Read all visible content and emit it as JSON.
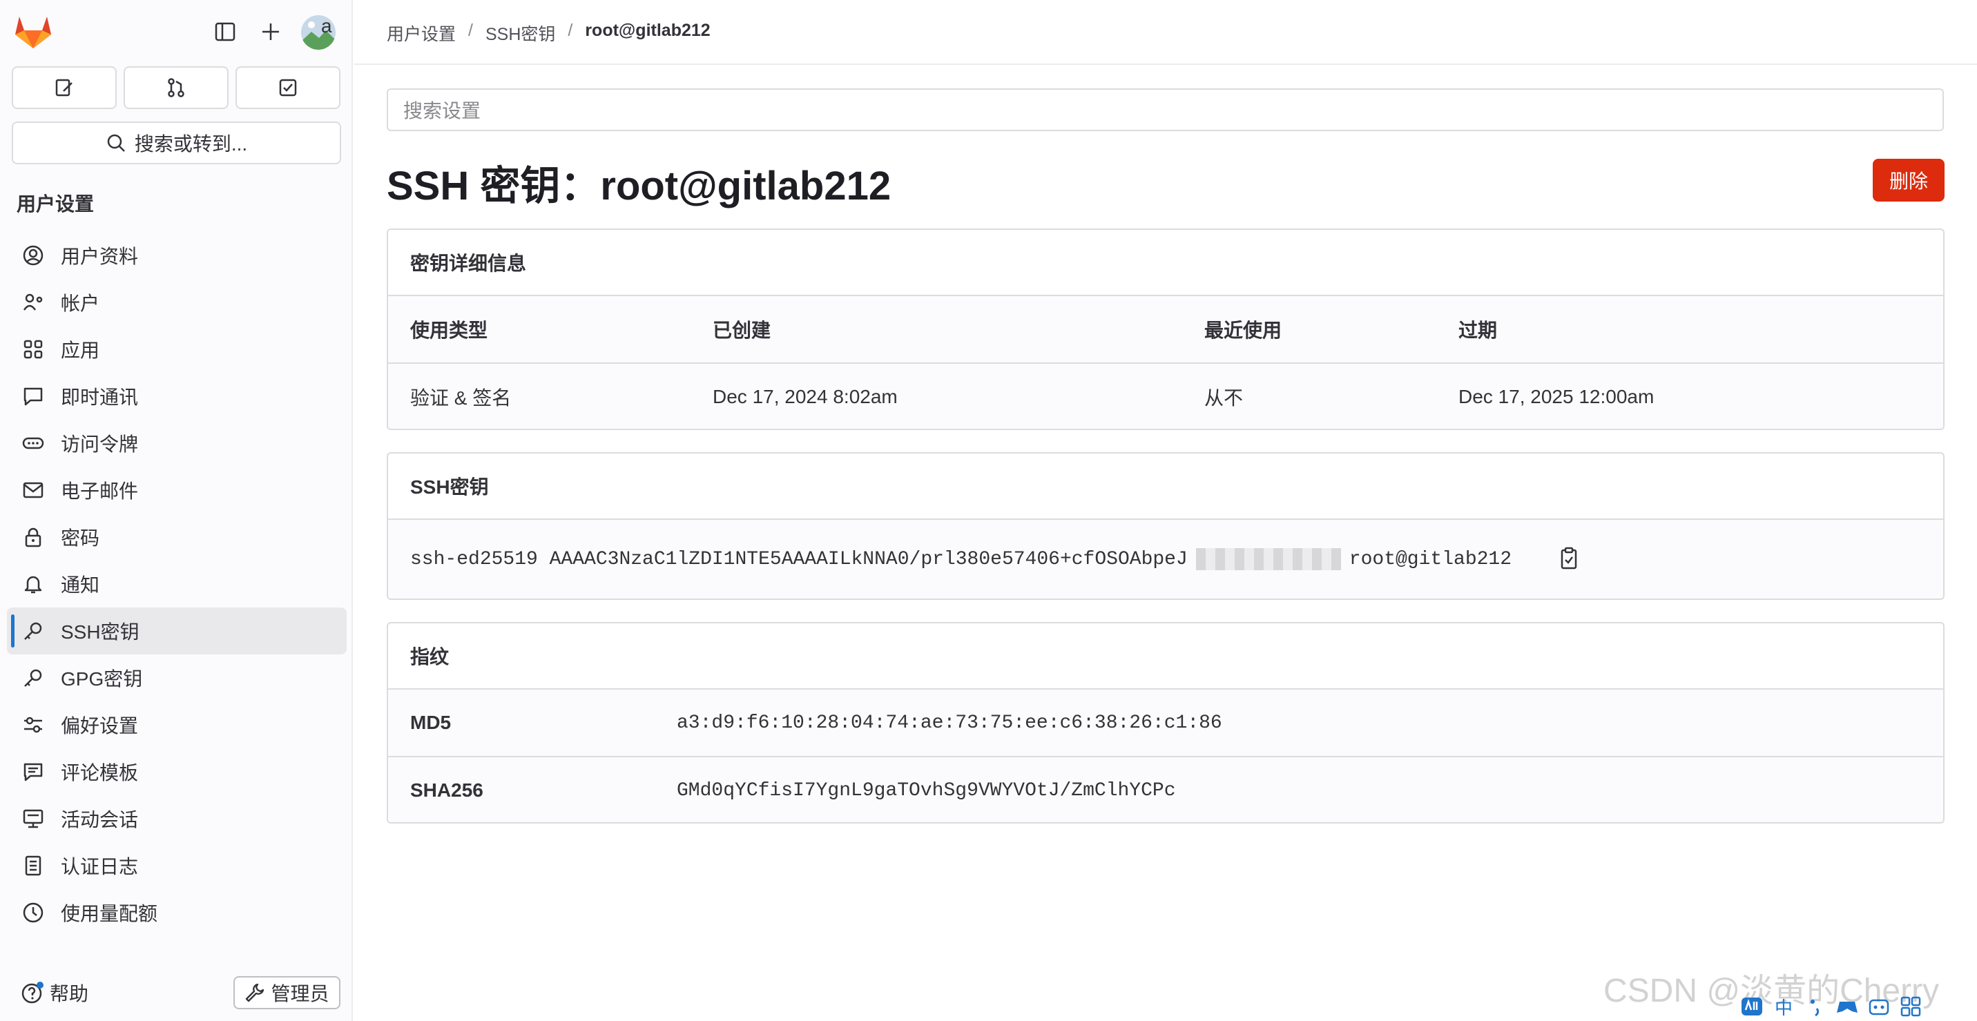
{
  "sidebar": {
    "avatar_text": "a",
    "search_label": "搜索或转到...",
    "section_title": "用户设置",
    "items": [
      {
        "label": "用户资料",
        "icon": "profile-icon"
      },
      {
        "label": "帐户",
        "icon": "account-icon"
      },
      {
        "label": "应用",
        "icon": "applications-icon"
      },
      {
        "label": "即时通讯",
        "icon": "chat-icon"
      },
      {
        "label": "访问令牌",
        "icon": "token-icon"
      },
      {
        "label": "电子邮件",
        "icon": "mail-icon"
      },
      {
        "label": "密码",
        "icon": "lock-icon"
      },
      {
        "label": "通知",
        "icon": "bell-icon"
      },
      {
        "label": "SSH密钥",
        "icon": "key-icon",
        "active": true
      },
      {
        "label": "GPG密钥",
        "icon": "key-icon"
      },
      {
        "label": "偏好设置",
        "icon": "preferences-icon"
      },
      {
        "label": "评论模板",
        "icon": "comment-template-icon"
      },
      {
        "label": "活动会话",
        "icon": "monitor-icon"
      },
      {
        "label": "认证日志",
        "icon": "log-icon"
      },
      {
        "label": "使用量配额",
        "icon": "quota-icon"
      }
    ],
    "help_label": "帮助",
    "admin_label": "管理员"
  },
  "breadcrumb": {
    "items": [
      "用户设置",
      "SSH密钥",
      "root@gitlab212"
    ],
    "separator": "/"
  },
  "search": {
    "placeholder": "搜索设置"
  },
  "page": {
    "title": "SSH 密钥：root@gitlab212",
    "delete_label": "删除"
  },
  "details_card": {
    "title": "密钥详细信息",
    "headers": [
      "使用类型",
      "已创建",
      "最近使用",
      "过期"
    ],
    "values": [
      "验证 & 签名",
      "Dec 17, 2024 8:02am",
      "从不",
      "Dec 17, 2025 12:00am"
    ]
  },
  "key_card": {
    "title": "SSH密钥",
    "key_prefix": "ssh-ed25519 AAAAC3NzaC1lZDI1NTE5AAAAILkNNA0/prl380e57406+cfOSOAbpeJ",
    "key_suffix": "root@gitlab212"
  },
  "fingerprint_card": {
    "title": "指纹",
    "rows": [
      {
        "label": "MD5",
        "value": "a3:d9:f6:10:28:04:74:ae:73:75:ee:c6:38:26:c1:86"
      },
      {
        "label": "SHA256",
        "value": "GMd0qYCfisI7YgnL9gaTOvhSg9VWYVOtJ/ZmClhYCPc"
      }
    ]
  },
  "watermark": "CSDN @淡黄的Cherry",
  "tray": [
    "中"
  ],
  "colors": {
    "accent": "#1f75cb",
    "danger": "#dd2b0e",
    "logo": "#e24329"
  }
}
